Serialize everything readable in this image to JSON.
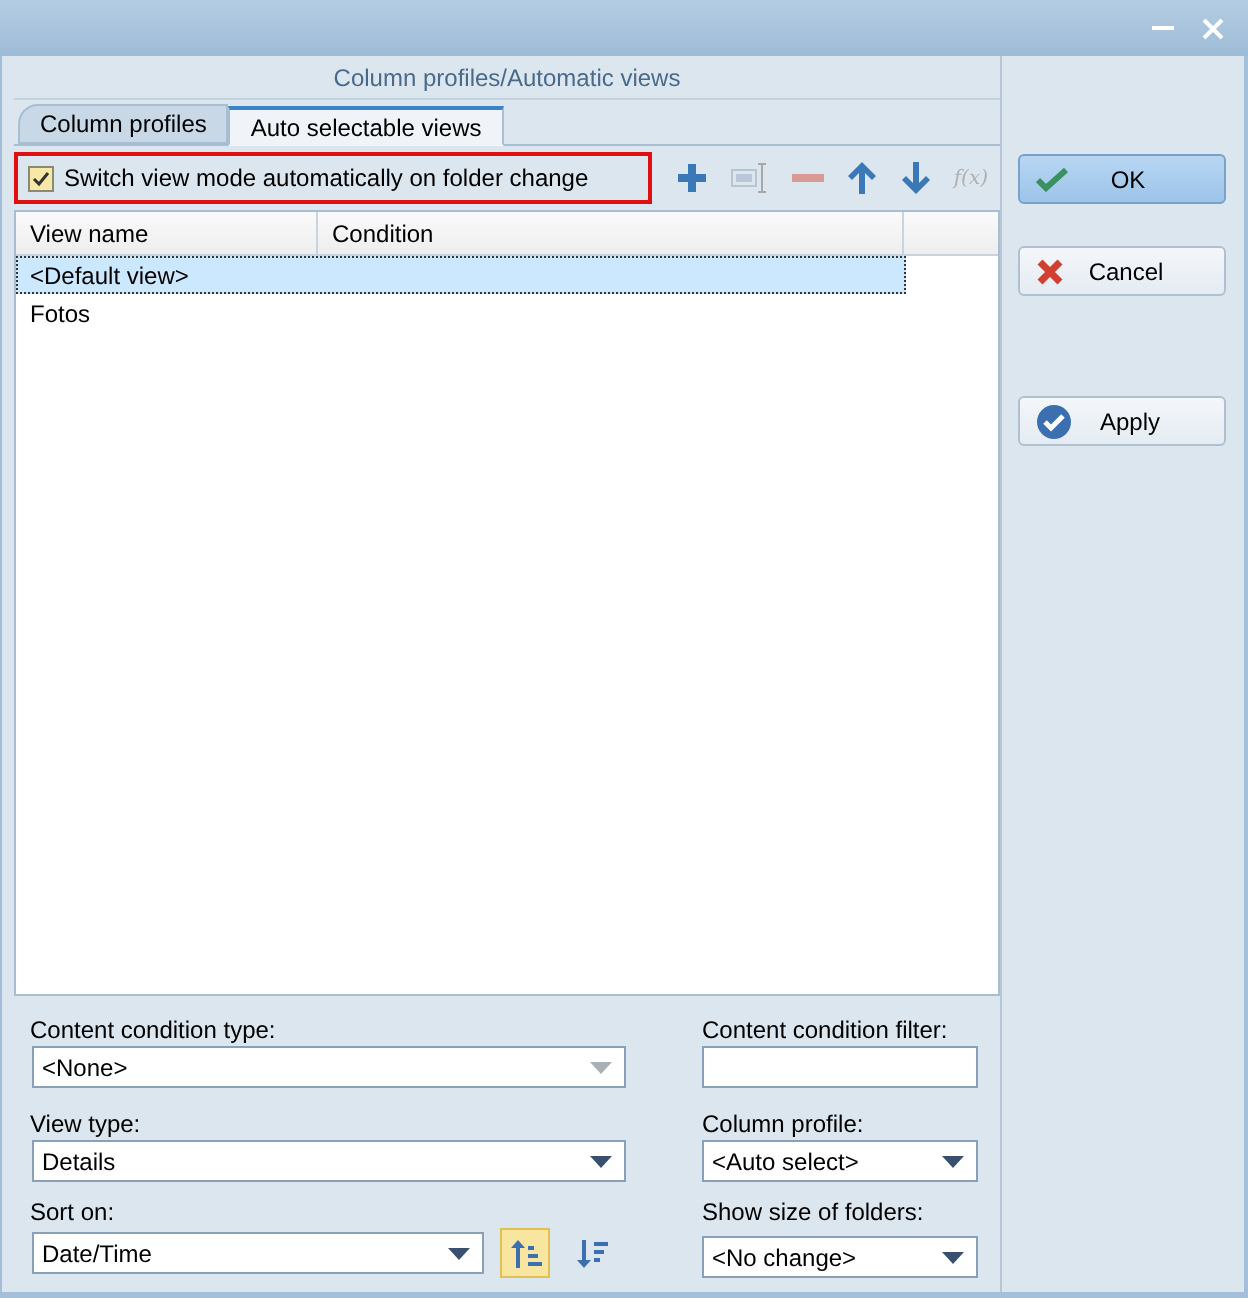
{
  "panel_title": "Column profiles/Automatic views",
  "tabs": [
    {
      "label": "Column profiles",
      "selected": false
    },
    {
      "label": "Auto selectable views",
      "selected": true
    }
  ],
  "auto_switch": {
    "label": "Switch view mode automatically on folder change",
    "checked": true,
    "highlighted": true
  },
  "toolbar": [
    {
      "kind": "add",
      "disabled": false
    },
    {
      "kind": "rename",
      "disabled": true
    },
    {
      "kind": "remove",
      "disabled": true
    },
    {
      "kind": "up",
      "disabled": false
    },
    {
      "kind": "down",
      "disabled": false
    },
    {
      "kind": "formula",
      "label": "f(x)",
      "disabled": true
    }
  ],
  "table": {
    "columns": [
      "View name",
      "Condition"
    ],
    "rows": [
      {
        "name": "<Default view>",
        "selected": true
      },
      {
        "name": "Fotos",
        "selected": false
      }
    ]
  },
  "form": {
    "content_condition_type": {
      "label": "Content condition type:",
      "value": "<None>",
      "disabled": true
    },
    "view_type": {
      "label": "View type:",
      "value": "Details",
      "disabled": false
    },
    "sort_on": {
      "label": "Sort on:",
      "value": "Date/Time",
      "disabled": false
    },
    "sort_order": [
      {
        "kind": "ascending",
        "selected": true
      },
      {
        "kind": "descending",
        "selected": false
      }
    ],
    "content_condition_filter": {
      "label": "Content condition filter:"
    },
    "column_profile": {
      "label": "Column profile:",
      "value": "<Auto select>",
      "disabled": false
    },
    "show_size_of_folders": {
      "label": "Show size of folders:",
      "value": "<No change>",
      "disabled": false
    }
  },
  "buttons": [
    {
      "label": "OK",
      "kind": "ok",
      "default": true
    },
    {
      "label": "Cancel",
      "kind": "cancel",
      "default": false
    },
    {
      "label": "Apply",
      "kind": "apply",
      "default": false
    }
  ]
}
